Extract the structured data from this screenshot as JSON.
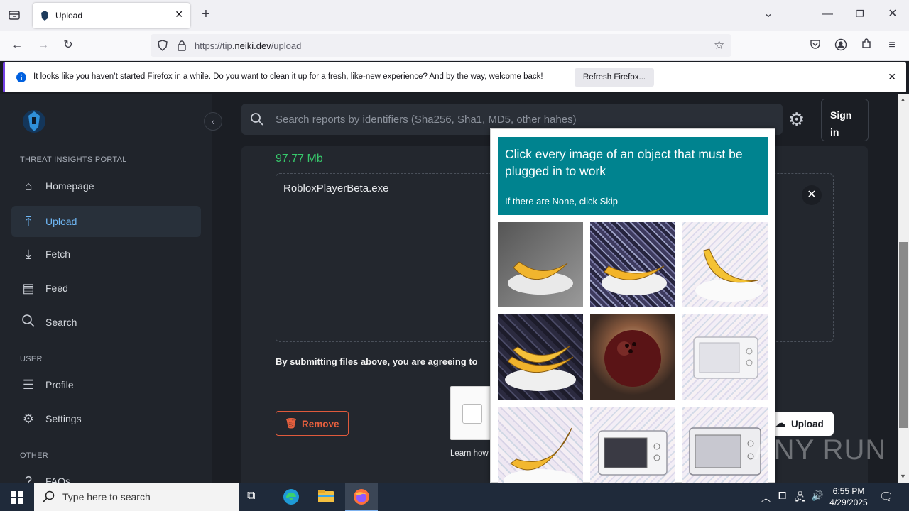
{
  "browser": {
    "tab_title": "Upload",
    "url_prefix": "https://tip.",
    "url_domain": "neiki.dev",
    "url_suffix": "/upload",
    "infobar_text": "It looks like you haven’t started Firefox in a while. Do you want to clean it up for a fresh, like-new experience? And by the way, welcome back!",
    "refresh_label": "Refresh Firefox..."
  },
  "sidebar": {
    "portal_label": "THREAT INSIGHTS PORTAL",
    "items": [
      {
        "label": "Homepage",
        "icon": "home-icon"
      },
      {
        "label": "Upload",
        "icon": "upload-icon"
      },
      {
        "label": "Fetch",
        "icon": "fetch-icon"
      },
      {
        "label": "Feed",
        "icon": "feed-icon"
      },
      {
        "label": "Search",
        "icon": "search-icon"
      }
    ],
    "user_label": "USER",
    "user_items": [
      {
        "label": "Profile",
        "icon": "profile-icon"
      },
      {
        "label": "Settings",
        "icon": "gear-icon"
      }
    ],
    "other_label": "OTHER",
    "other_items": [
      {
        "label": "FAQs",
        "icon": "faq-icon"
      }
    ]
  },
  "header": {
    "search_placeholder": "Search reports by identifiers (Sha256, Sha1, MD5, other hahes)",
    "signin_label": "Sign in"
  },
  "upload": {
    "file_size": "97.77 Mb",
    "file_name": "RobloxPlayerBeta.exe",
    "agreement_text": "By submitting files above, you are agreeing to",
    "remove_label": "Remove",
    "learn_text": "Learn how",
    "upload_label": "Upload"
  },
  "captcha": {
    "title": "Click every image of an object that must be plugged in to work",
    "subtitle": "If there are None, click Skip",
    "tiles": [
      "banana",
      "banana",
      "banana",
      "banana",
      "bowling-ball",
      "microwave",
      "banana",
      "microwave",
      "microwave"
    ]
  },
  "taskbar": {
    "search_placeholder": "Type here to search",
    "time": "6:55 PM",
    "date": "4/29/2025"
  },
  "watermark": "ANY RUN"
}
